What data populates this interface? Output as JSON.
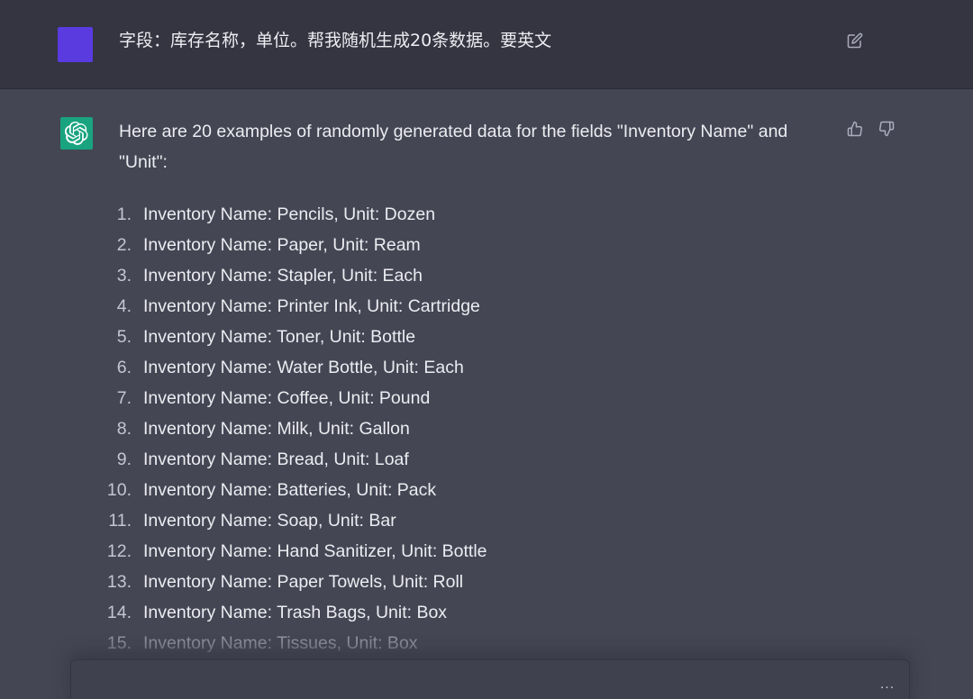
{
  "colors": {
    "user_avatar": "#5a3be0",
    "bot_avatar": "#19a37f",
    "user_row_bg": "#343541",
    "assistant_row_bg": "#444654"
  },
  "user_message": {
    "text": "字段：库存名称，单位。帮我随机生成20条数据。要英文",
    "edit_icon": "edit-icon"
  },
  "assistant_message": {
    "intro": "Here are 20 examples of randomly generated data for the fields \"Inventory Name\" and \"Unit\":",
    "feedback_icons": [
      "thumbs-up-icon",
      "thumbs-down-icon"
    ],
    "items": [
      {
        "num": "1.",
        "text": "Inventory Name: Pencils, Unit: Dozen"
      },
      {
        "num": "2.",
        "text": "Inventory Name: Paper, Unit: Ream"
      },
      {
        "num": "3.",
        "text": "Inventory Name: Stapler, Unit: Each"
      },
      {
        "num": "4.",
        "text": "Inventory Name: Printer Ink, Unit: Cartridge"
      },
      {
        "num": "5.",
        "text": "Inventory Name: Toner, Unit: Bottle"
      },
      {
        "num": "6.",
        "text": "Inventory Name: Water Bottle, Unit: Each"
      },
      {
        "num": "7.",
        "text": "Inventory Name: Coffee, Unit: Pound"
      },
      {
        "num": "8.",
        "text": "Inventory Name: Milk, Unit: Gallon"
      },
      {
        "num": "9.",
        "text": "Inventory Name: Bread, Unit: Loaf"
      },
      {
        "num": "10.",
        "text": "Inventory Name: Batteries, Unit: Pack"
      },
      {
        "num": "11.",
        "text": "Inventory Name: Soap, Unit: Bar"
      },
      {
        "num": "12.",
        "text": "Inventory Name: Hand Sanitizer, Unit: Bottle"
      },
      {
        "num": "13.",
        "text": "Inventory Name: Paper Towels, Unit: Roll"
      },
      {
        "num": "14.",
        "text": "Inventory Name: Trash Bags, Unit: Box"
      },
      {
        "num": "15.",
        "text": "Inventory Name: Tissues, Unit: Box"
      }
    ]
  },
  "input": {
    "more_label": "..."
  }
}
